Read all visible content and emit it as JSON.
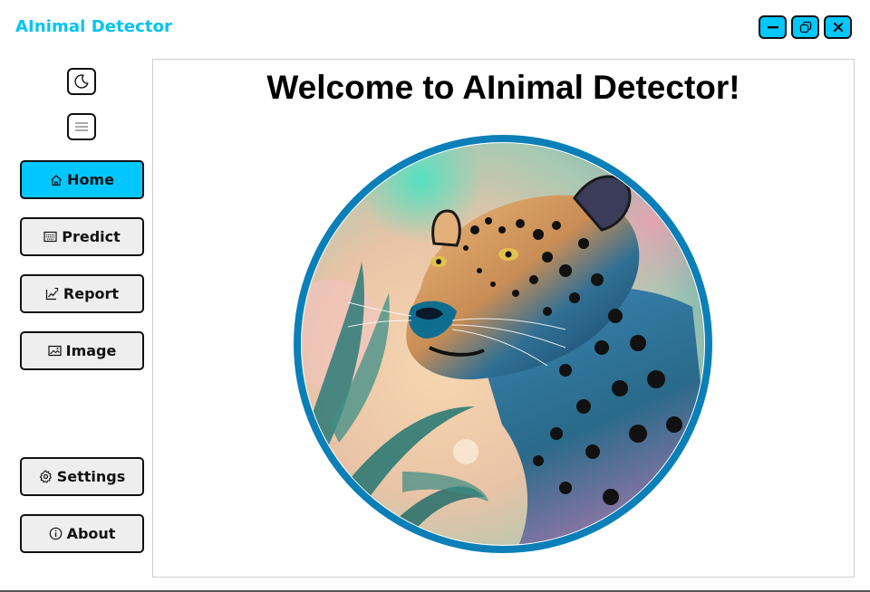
{
  "window": {
    "title": "AInimal Detector",
    "buttons": [
      {
        "name": "minimize",
        "icon": "minimize-icon"
      },
      {
        "name": "maximize",
        "icon": "restore-icon"
      },
      {
        "name": "close",
        "icon": "close-icon"
      }
    ]
  },
  "sidebar": {
    "theme_toggle_icon": "moon-icon",
    "menu_toggle_icon": "hamburger-icon",
    "items": [
      {
        "label": "Home",
        "icon": "home-icon",
        "active": true
      },
      {
        "label": "Predict",
        "icon": "keyboard-icon",
        "active": false
      },
      {
        "label": "Report",
        "icon": "chart-icon",
        "active": false
      },
      {
        "label": "Image",
        "icon": "image-icon",
        "active": false
      }
    ],
    "bottom_items": [
      {
        "label": "Settings",
        "icon": "gear-icon"
      },
      {
        "label": "About",
        "icon": "info-icon"
      }
    ]
  },
  "main": {
    "heading": "Welcome to AInimal Detector!",
    "hero_image": "jaguar-illustration"
  },
  "colors": {
    "accent": "#00c8ff",
    "title": "#00c4f0",
    "button_bg": "#eeeeee",
    "hero_ring": "#0a7fb8"
  }
}
